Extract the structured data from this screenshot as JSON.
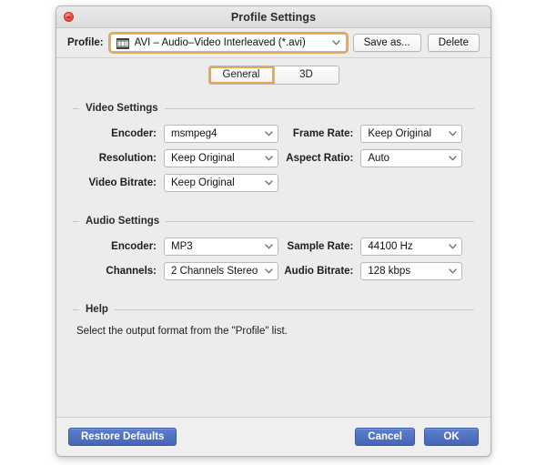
{
  "window": {
    "title": "Profile Settings",
    "close_icon": "close-traffic-light-icon"
  },
  "profile_bar": {
    "label": "Profile:",
    "icon": "film-strip-icon",
    "selected_value": "AVI – Audio–Video Interleaved (*.avi)",
    "save_as_label": "Save as...",
    "delete_label": "Delete",
    "focus_ring_color": "#e89b3c"
  },
  "tabs": [
    {
      "label": "General",
      "selected": true
    },
    {
      "label": "3D",
      "selected": false
    }
  ],
  "video_settings": {
    "legend": "Video Settings",
    "rows": [
      {
        "left": {
          "label": "Encoder:",
          "value": "msmpeg4"
        },
        "right": {
          "label": "Frame Rate:",
          "value": "Keep Original"
        }
      },
      {
        "left": {
          "label": "Resolution:",
          "value": "Keep Original"
        },
        "right": {
          "label": "Aspect Ratio:",
          "value": "Auto"
        }
      },
      {
        "left": {
          "label": "Video Bitrate:",
          "value": "Keep Original"
        },
        "right": {
          "label": "",
          "value": ""
        }
      }
    ]
  },
  "audio_settings": {
    "legend": "Audio Settings",
    "rows": [
      {
        "left": {
          "label": "Encoder:",
          "value": "MP3"
        },
        "right": {
          "label": "Sample Rate:",
          "value": "44100 Hz"
        }
      },
      {
        "left": {
          "label": "Channels:",
          "value": "2 Channels Stereo"
        },
        "right": {
          "label": "Audio Bitrate:",
          "value": "128 kbps"
        }
      }
    ]
  },
  "help": {
    "legend": "Help",
    "text": "Select the output format from the \"Profile\" list."
  },
  "footer": {
    "restore_defaults_label": "Restore Defaults",
    "cancel_label": "Cancel",
    "ok_label": "OK",
    "button_color": "#4a6bbd"
  }
}
